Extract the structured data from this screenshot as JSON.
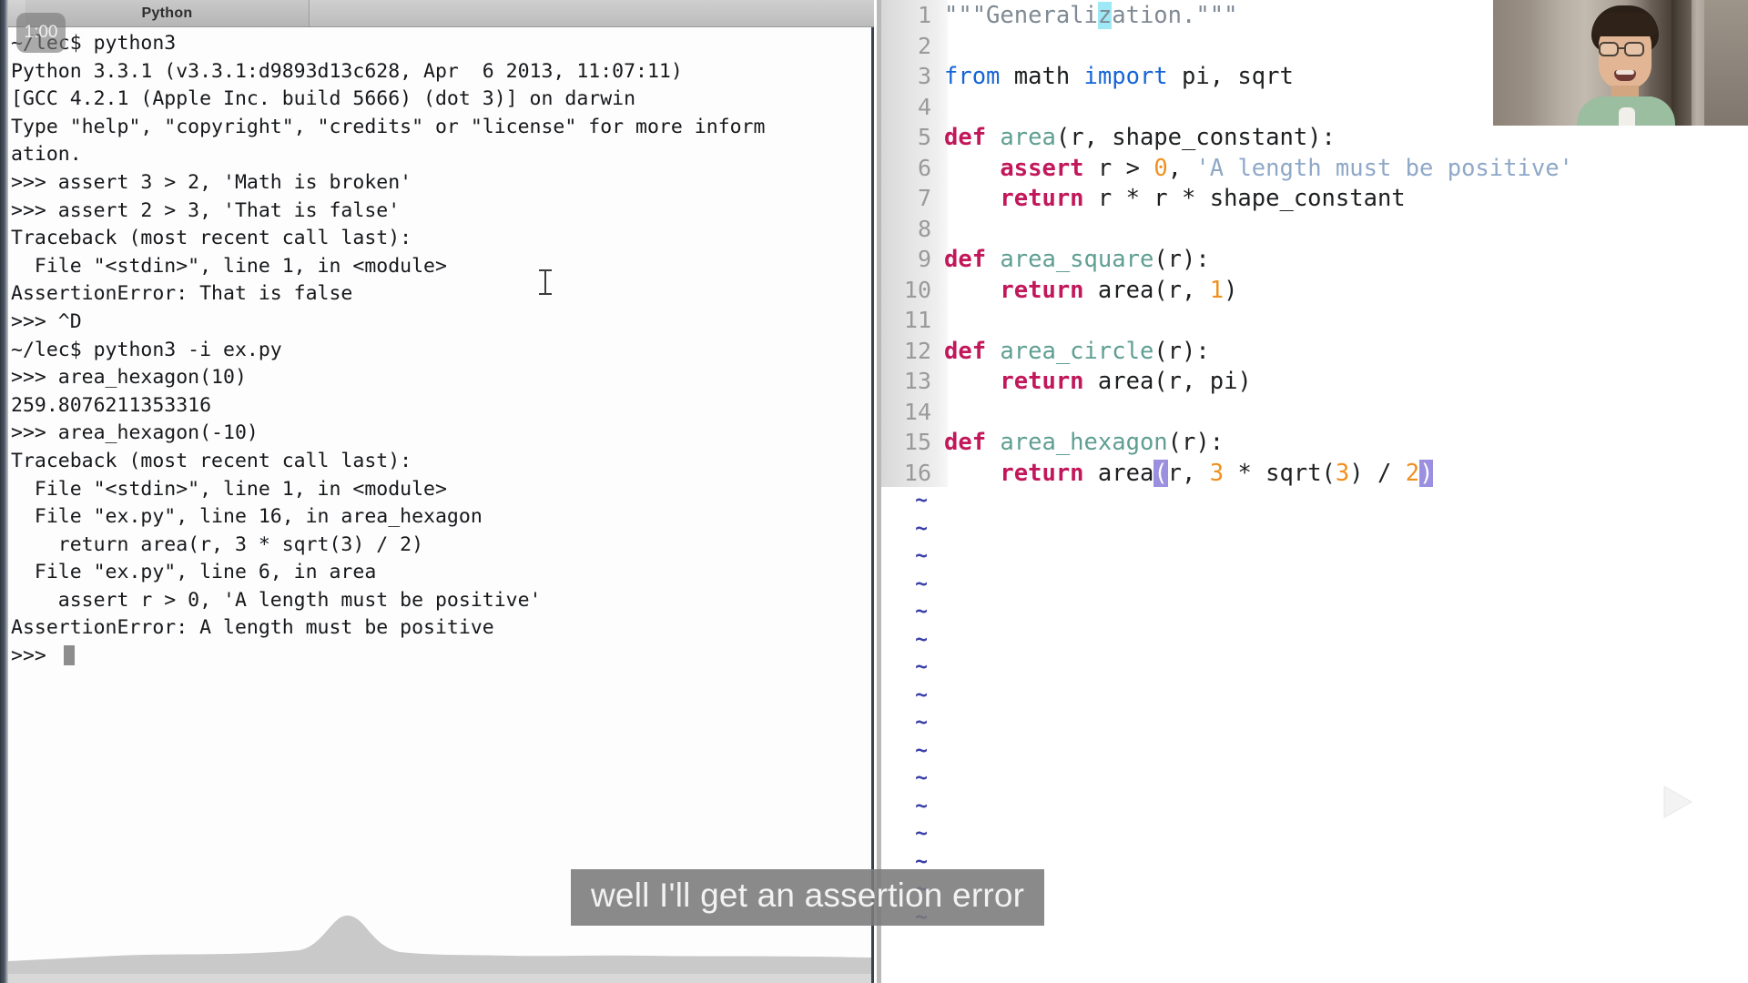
{
  "window": {
    "tab_label": "Python",
    "overlay_badge": "1:00"
  },
  "terminal": {
    "lines": [
      "~/lec$ python3",
      "Python 3.3.1 (v3.3.1:d9893d13c628, Apr  6 2013, 11:07:11)",
      "[GCC 4.2.1 (Apple Inc. build 5666) (dot 3)] on darwin",
      "Type \"help\", \"copyright\", \"credits\" or \"license\" for more inform",
      "ation.",
      ">>> assert 3 > 2, 'Math is broken'",
      ">>> assert 2 > 3, 'That is false'",
      "Traceback (most recent call last):",
      "  File \"<stdin>\", line 1, in <module>",
      "AssertionError: That is false",
      ">>> ^D",
      "~/lec$ python3 -i ex.py",
      ">>> area_hexagon(10)",
      "259.8076211353316",
      ">>> area_hexagon(-10)",
      "Traceback (most recent call last):",
      "  File \"<stdin>\", line 1, in <module>",
      "  File \"ex.py\", line 16, in area_hexagon",
      "    return area(r, 3 * sqrt(3) / 2)",
      "  File \"ex.py\", line 6, in area",
      "    assert r > 0, 'A length must be positive'",
      "AssertionError: A length must be positive"
    ],
    "prompt": ">>> "
  },
  "editor": {
    "filename": "ex.py",
    "line_numbers": [
      "1",
      "2",
      "3",
      "4",
      "5",
      "6",
      "7",
      "8",
      "9",
      "10",
      "11",
      "12",
      "13",
      "14",
      "15",
      "16"
    ],
    "tilde_count": 16,
    "tilde_glyph": "~",
    "lines": [
      {
        "n": "1",
        "tokens": [
          {
            "t": "\"\"\"Generali",
            "c": "doc"
          },
          {
            "t": "z",
            "c": "doc hl-cyan"
          },
          {
            "t": "ation.\"\"\"",
            "c": "doc"
          }
        ]
      },
      {
        "n": "2",
        "tokens": []
      },
      {
        "n": "3",
        "tokens": [
          {
            "t": "from",
            "c": "imp"
          },
          {
            "t": " math ",
            "c": ""
          },
          {
            "t": "import",
            "c": "imp"
          },
          {
            "t": " pi, sqrt",
            "c": ""
          }
        ]
      },
      {
        "n": "4",
        "tokens": []
      },
      {
        "n": "5",
        "tokens": [
          {
            "t": "def",
            "c": "kw"
          },
          {
            "t": " ",
            "c": ""
          },
          {
            "t": "area",
            "c": "fn"
          },
          {
            "t": "(r, shape_constant):",
            "c": ""
          }
        ]
      },
      {
        "n": "6",
        "tokens": [
          {
            "t": "    ",
            "c": ""
          },
          {
            "t": "assert",
            "c": "kw"
          },
          {
            "t": " r > ",
            "c": ""
          },
          {
            "t": "0",
            "c": "num"
          },
          {
            "t": ", ",
            "c": ""
          },
          {
            "t": "'A length must be positive'",
            "c": "str"
          }
        ]
      },
      {
        "n": "7",
        "tokens": [
          {
            "t": "    ",
            "c": ""
          },
          {
            "t": "return",
            "c": "kw"
          },
          {
            "t": " r * r * shape_constant",
            "c": ""
          }
        ]
      },
      {
        "n": "8",
        "tokens": []
      },
      {
        "n": "9",
        "tokens": [
          {
            "t": "def",
            "c": "kw"
          },
          {
            "t": " ",
            "c": ""
          },
          {
            "t": "area_square",
            "c": "fn"
          },
          {
            "t": "(r):",
            "c": ""
          }
        ]
      },
      {
        "n": "10",
        "tokens": [
          {
            "t": "    ",
            "c": ""
          },
          {
            "t": "return",
            "c": "kw"
          },
          {
            "t": " area(r, ",
            "c": ""
          },
          {
            "t": "1",
            "c": "num"
          },
          {
            "t": ")",
            "c": ""
          }
        ]
      },
      {
        "n": "11",
        "tokens": []
      },
      {
        "n": "12",
        "tokens": [
          {
            "t": "def",
            "c": "kw"
          },
          {
            "t": " ",
            "c": ""
          },
          {
            "t": "area_circle",
            "c": "fn"
          },
          {
            "t": "(r):",
            "c": ""
          }
        ]
      },
      {
        "n": "13",
        "tokens": [
          {
            "t": "    ",
            "c": ""
          },
          {
            "t": "return",
            "c": "kw"
          },
          {
            "t": " area(r, pi)",
            "c": ""
          }
        ]
      },
      {
        "n": "14",
        "tokens": []
      },
      {
        "n": "15",
        "tokens": [
          {
            "t": "def",
            "c": "kw"
          },
          {
            "t": " ",
            "c": ""
          },
          {
            "t": "area_hexagon",
            "c": "fn"
          },
          {
            "t": "(r):",
            "c": ""
          }
        ]
      },
      {
        "n": "16",
        "tokens": [
          {
            "t": "    ",
            "c": ""
          },
          {
            "t": "return",
            "c": "kw"
          },
          {
            "t": " area",
            "c": ""
          },
          {
            "t": "(",
            "c": "paren-hl"
          },
          {
            "t": "r, ",
            "c": ""
          },
          {
            "t": "3",
            "c": "num"
          },
          {
            "t": " * sqrt(",
            "c": ""
          },
          {
            "t": "3",
            "c": "num"
          },
          {
            "t": ") / ",
            "c": ""
          },
          {
            "t": "2",
            "c": "num"
          },
          {
            "t": ")",
            "c": "paren-hl"
          }
        ]
      }
    ]
  },
  "caption": {
    "text": "well I'll get an assertion error"
  },
  "webcam": {
    "label": "instructor-video"
  },
  "watermark": {
    "label": "play-logo"
  },
  "colors": {
    "keyword": "#c2185b",
    "function": "#5f9e92",
    "number": "#f0901e",
    "string": "#8fa8c8",
    "import": "#1565d8",
    "docstring": "#7f8a94",
    "paren_highlight": "#9b8fe0",
    "search_highlight": "#9fe8f5",
    "tilde": "#3b3fa8",
    "caption_bg": "#7a7a7a",
    "terminal_bg": "#fdfdfd",
    "terminal_text": "#16181b"
  }
}
